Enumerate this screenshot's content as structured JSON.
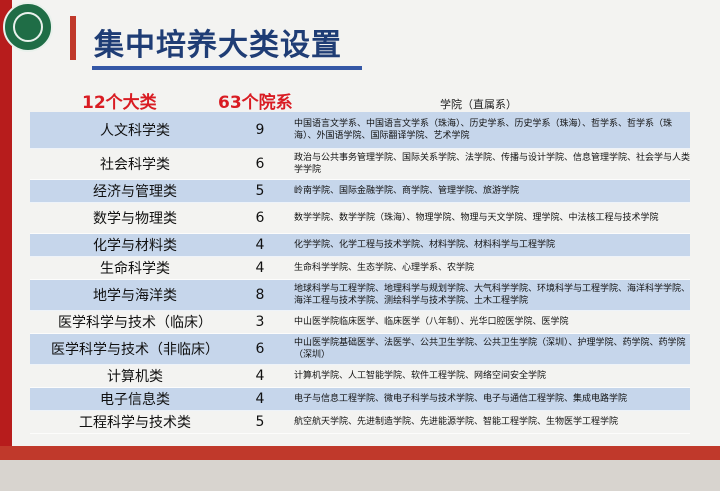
{
  "slide": {
    "title": "集中培养大类设置",
    "header": {
      "categories": "12个大类",
      "departments": "63个院系",
      "colleges": "学院（直属系）"
    },
    "colors": {
      "title": "#1f3d75",
      "header_red": "#d91c23",
      "row_blue": "#c6d6eb",
      "accent_red": "#b71c1c"
    }
  },
  "rows": [
    {
      "category": "人文科学类",
      "count": "9",
      "depts": "中国语言文学系、中国语言文学系（珠海）、历史学系、历史学系（珠海）、哲学系、哲学系（珠海）、外国语学院、国际翻译学院、艺术学院"
    },
    {
      "category": "社会科学类",
      "count": "6",
      "depts": "政治与公共事务管理学院、国际关系学院、法学院、传播与设计学院、信息管理学院、社会学与人类学学院"
    },
    {
      "category": "经济与管理类",
      "count": "5",
      "depts": "岭南学院、国际金融学院、商学院、管理学院、旅游学院"
    },
    {
      "category": "数学与物理类",
      "count": "6",
      "depts": "数学学院、数学学院（珠海）、物理学院、物理与天文学院、理学院、中法核工程与技术学院"
    },
    {
      "category": "化学与材料类",
      "count": "4",
      "depts": "化学学院、化学工程与技术学院、材料学院、材料科学与工程学院"
    },
    {
      "category": "生命科学类",
      "count": "4",
      "depts": "生命科学学院、生态学院、心理学系、农学院"
    },
    {
      "category": "地学与海洋类",
      "count": "8",
      "depts": "地球科学与工程学院、地理科学与规划学院、大气科学学院、环境科学与工程学院、海洋科学学院、海洋工程与技术学院、测绘科学与技术学院、土木工程学院"
    },
    {
      "category": "医学科学与技术（临床）",
      "count": "3",
      "depts": "中山医学院临床医学、临床医学（八年制）、光华口腔医学院、医学院"
    },
    {
      "category": "医学科学与技术（非临床）",
      "count": "6",
      "depts": "中山医学院基础医学、法医学、公共卫生学院、公共卫生学院（深圳）、护理学院、药学院、药学院（深圳）"
    },
    {
      "category": "计算机类",
      "count": "4",
      "depts": "计算机学院、人工智能学院、软件工程学院、网络空间安全学院"
    },
    {
      "category": "电子信息类",
      "count": "4",
      "depts": "电子与信息工程学院、微电子科学与技术学院、电子与通信工程学院、集成电路学院"
    },
    {
      "category": "工程科学与技术类",
      "count": "5",
      "depts": "航空航天学院、先进制造学院、先进能源学院、智能工程学院、生物医学工程学院"
    }
  ]
}
